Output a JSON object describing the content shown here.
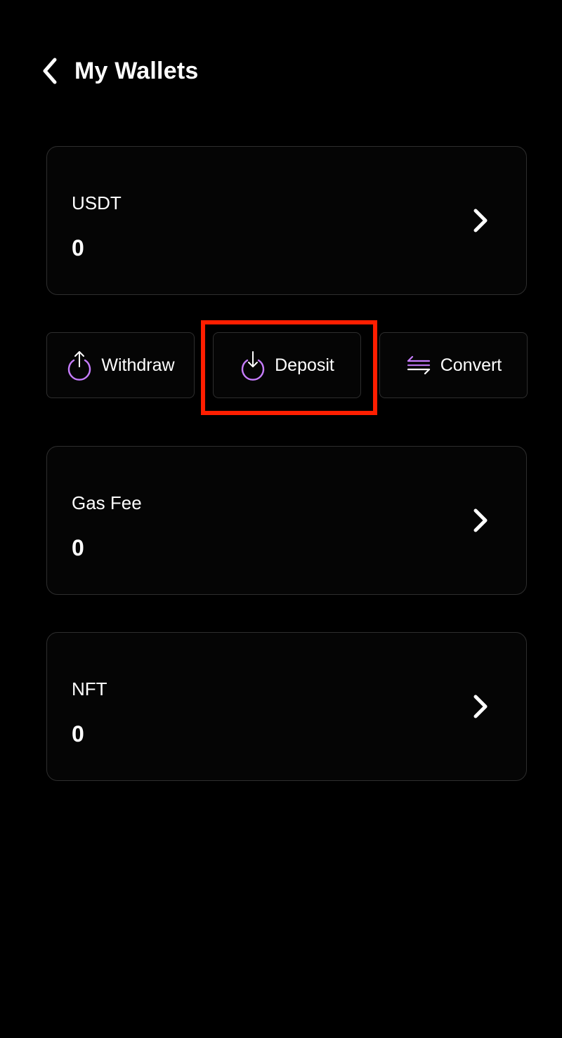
{
  "header": {
    "title": "My Wallets",
    "back_icon": "chevron-left-icon"
  },
  "wallets": [
    {
      "label": "USDT",
      "value": "0",
      "chevron_icon": "chevron-right-icon"
    },
    {
      "label": "Gas Fee",
      "value": "0",
      "chevron_icon": "chevron-right-icon"
    },
    {
      "label": "NFT",
      "value": "0",
      "chevron_icon": "chevron-right-icon"
    }
  ],
  "actions": [
    {
      "label": "Withdraw",
      "icon": "withdraw-icon"
    },
    {
      "label": "Deposit",
      "icon": "deposit-icon"
    },
    {
      "label": "Convert",
      "icon": "convert-arrows-icon"
    }
  ],
  "colors": {
    "background": "#000000",
    "card_border": "#2e2e2e",
    "accent_purple": "#c77dff",
    "highlight": "#ff1e00",
    "text": "#ffffff"
  }
}
